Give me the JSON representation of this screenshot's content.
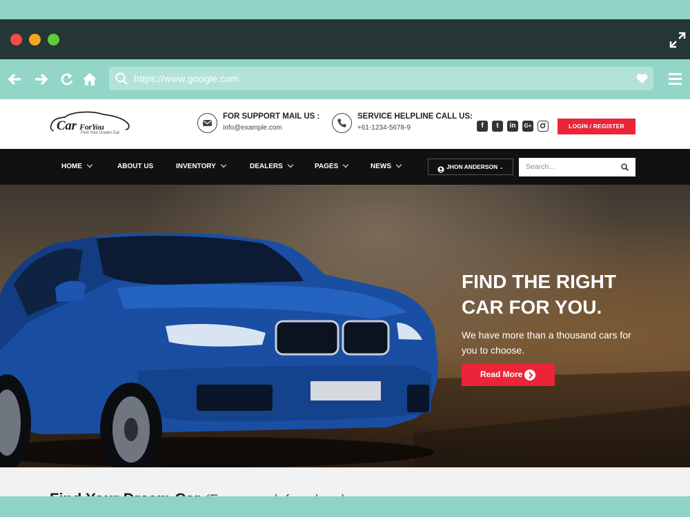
{
  "browser": {
    "url": "https://www.google.com"
  },
  "header": {
    "logo_text": "Car",
    "logo_text_small": "ForYou",
    "logo_tagline": "Find Your Dream Car",
    "support": {
      "title": "FOR SUPPORT MAIL US :",
      "value": "info@example.com"
    },
    "helpline": {
      "title": "SERVICE HELPLINE CALL US:",
      "value": "+61-1234-5678-9"
    },
    "socials": [
      "facebook-icon",
      "twitter-icon",
      "linkedin-icon",
      "google-plus-icon",
      "instagram-icon"
    ],
    "login_label": "LOGIN / REGISTER"
  },
  "nav": {
    "items": [
      {
        "label": "HOME",
        "dropdown": true
      },
      {
        "label": "ABOUT US",
        "dropdown": false
      },
      {
        "label": "INVENTORY",
        "dropdown": true
      },
      {
        "label": "DEALERS",
        "dropdown": true
      },
      {
        "label": "PAGES",
        "dropdown": true
      },
      {
        "label": "NEWS",
        "dropdown": true
      }
    ],
    "user": "JHON ANDERSON",
    "search_placeholder": "Search..."
  },
  "hero": {
    "title_line1": "FIND THE RIGHT",
    "title_line2": "CAR FOR YOU.",
    "subtitle": "We have more than a thousand cars for you to choose.",
    "button": "Read More"
  },
  "below": {
    "title": "Find Your Dream Car",
    "subtitle": "(Easy search from here)"
  },
  "colors": {
    "accent": "#ec2439",
    "frame": "#8fd3c4",
    "titlebar": "#263634",
    "nav_bg": "#111111"
  }
}
